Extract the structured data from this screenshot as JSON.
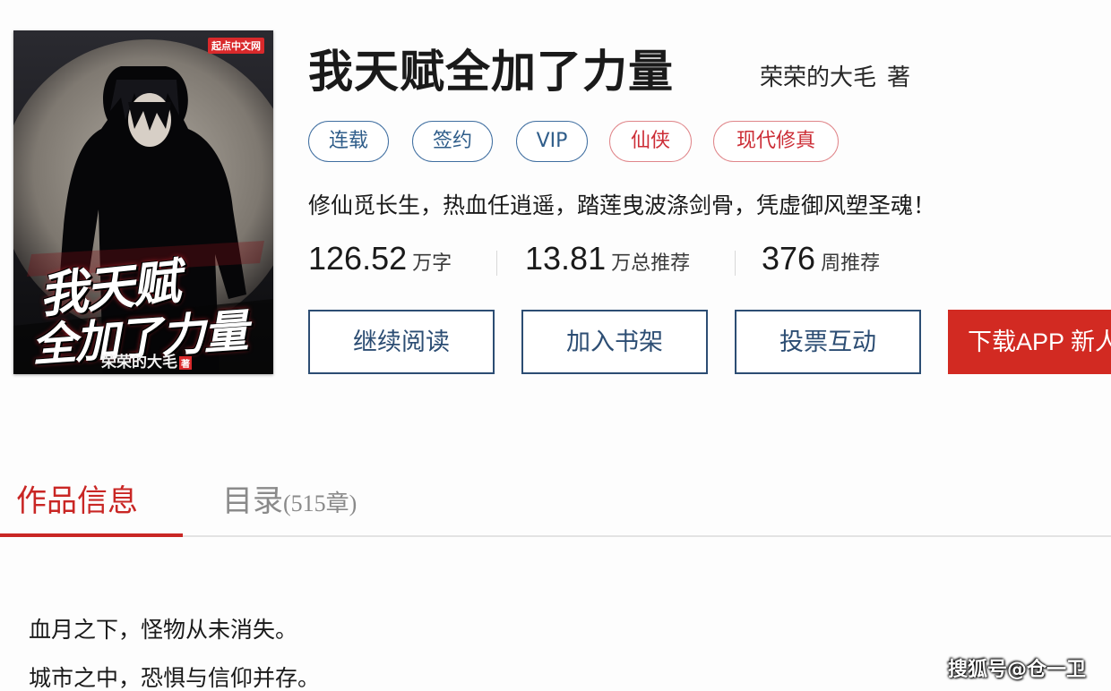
{
  "cover": {
    "publisher_badge": "起点中文网",
    "title_line1": "我天赋",
    "title_line2": "全加了力量",
    "author": "荣荣的大毛",
    "author_mark": "著"
  },
  "book": {
    "title": "我天赋全加了力量",
    "author": "荣荣的大毛",
    "author_suffix": "著",
    "tags": [
      {
        "label": "连载",
        "style": "blue"
      },
      {
        "label": "签约",
        "style": "blue"
      },
      {
        "label": "VIP",
        "style": "blue"
      },
      {
        "label": "仙侠",
        "style": "red"
      },
      {
        "label": "现代修真",
        "style": "red"
      }
    ],
    "intro": "修仙觅长生，热血任逍遥，踏莲曳波涤剑骨，凭虚御风塑圣魂！",
    "stats": [
      {
        "value": "126.52",
        "unit": "万字"
      },
      {
        "value": "13.81",
        "unit": "万总推荐"
      },
      {
        "value": "376",
        "unit": "周推荐"
      }
    ]
  },
  "actions": {
    "continue_reading": "继续阅读",
    "add_to_shelf": "加入书架",
    "vote": "投票互动",
    "download_app": "下载APP 新人"
  },
  "tabs": {
    "info": "作品信息",
    "toc": "目录",
    "toc_count": "(515章)"
  },
  "description": [
    "血月之下，怪物从未消失。",
    "城市之中，恐惧与信仰并存。"
  ],
  "watermark": "搜狐号@仓一卫",
  "colors": {
    "accent_red": "#c92624",
    "button_red": "#d22a22",
    "tag_blue": "#2f5d8a",
    "button_border": "#2c4d73"
  }
}
